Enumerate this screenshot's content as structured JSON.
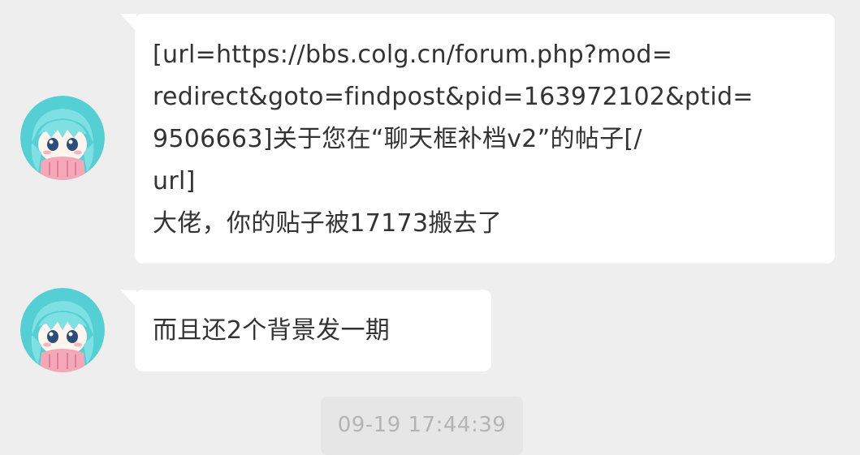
{
  "messages": [
    {
      "lines": [
        "[url=https://bbs.colg.cn/forum.php?mod=",
        "redirect&goto=findpost&pid=163972102&ptid=",
        "9506663]关于您在“聊天框补档v2”的帖子[/",
        "url]",
        "大佬，你的贴子被17173搬去了"
      ]
    },
    {
      "lines": [
        "而且还2个背景发一期"
      ]
    }
  ],
  "timestamp": "09-19 17:44:39",
  "colors": {
    "background": "#eeeeee",
    "bubble": "#ffffff",
    "text": "#333333",
    "timestamp_bg": "#e6e6e6",
    "timestamp_text": "#b4b4b4",
    "avatar_bg": "#54cfd4"
  },
  "icons": {
    "avatar": "anime-girl-avatar-icon"
  }
}
